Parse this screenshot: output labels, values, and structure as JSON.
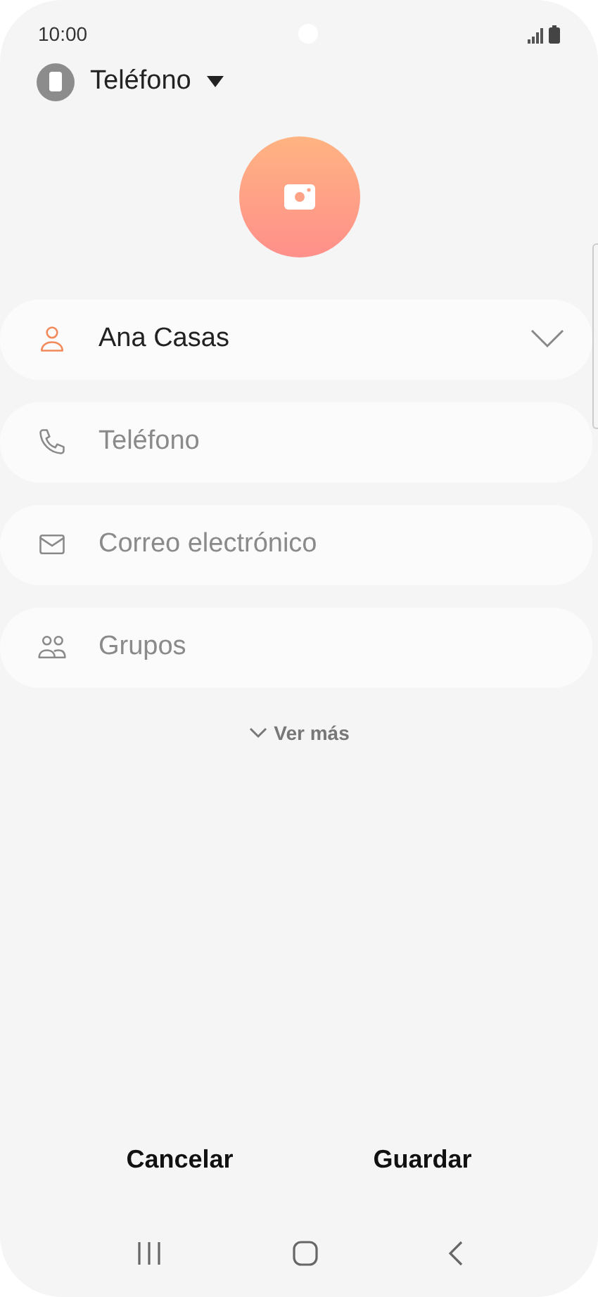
{
  "status_bar": {
    "time": "10:00"
  },
  "account": {
    "label": "Teléfono"
  },
  "fields": [
    {
      "kind": "name",
      "value": "Ana Casas",
      "active": true
    },
    {
      "kind": "phone",
      "placeholder": "Teléfono",
      "active": false
    },
    {
      "kind": "email",
      "placeholder": "Correo electrónico",
      "active": false
    },
    {
      "kind": "groups",
      "placeholder": "Grupos",
      "active": false
    }
  ],
  "more_link": "Ver más",
  "buttons": [
    "Cancelar",
    "Guardar"
  ]
}
